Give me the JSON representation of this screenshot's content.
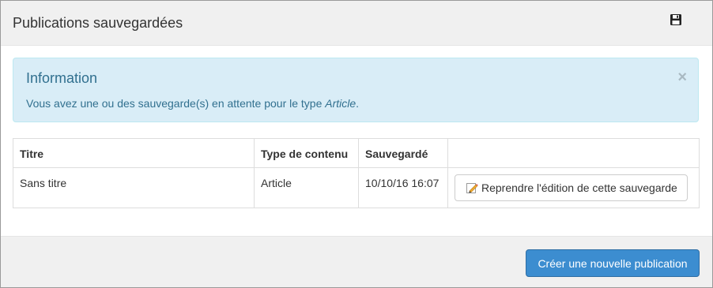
{
  "modal": {
    "title": "Publications sauvegardées",
    "save_icon": "floppy-disk-icon"
  },
  "alert": {
    "heading": "Information",
    "text_prefix": "Vous avez une ou des sauvegarde(s) en attente pour le type ",
    "text_type": "Article",
    "text_suffix": ".",
    "close_symbol": "×",
    "color_bg": "#d9edf7",
    "color_text": "#31708f"
  },
  "table": {
    "headers": [
      "Titre",
      "Type de contenu",
      "Sauvegardé",
      ""
    ],
    "rows": [
      {
        "title": "Sans titre",
        "type": "Article",
        "saved": "10/10/16 16:07",
        "action_label": "Reprendre l'édition de cette sauvegarde",
        "action_icon": "pencil-icon"
      }
    ]
  },
  "footer": {
    "primary_label": "Créer une nouvelle publication",
    "primary_color": "#3c8dd0"
  }
}
